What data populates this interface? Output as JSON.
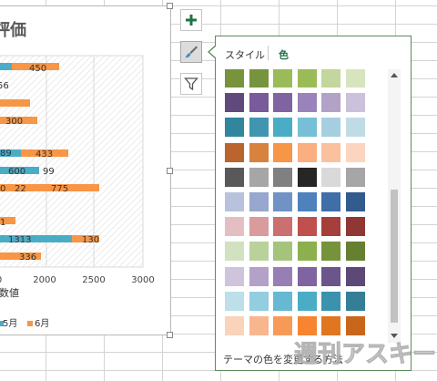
{
  "chart": {
    "title": "評価",
    "axis_title": "数値",
    "x_ticks": [
      "0",
      "2000",
      "2500",
      "3000"
    ],
    "bar_labels": [
      {
        "text": "450",
        "color": "orange"
      },
      {
        "text": "56",
        "color": "cyan"
      },
      {
        "text": "300",
        "color": "orange"
      },
      {
        "text": "89",
        "color": "cyan"
      },
      {
        "text": "433",
        "color": "orange"
      },
      {
        "text": "600",
        "color": "cyan"
      },
      {
        "text": "99",
        "color": "orange"
      },
      {
        "text": "0",
        "color": "cyan"
      },
      {
        "text": "22",
        "color": "cyan"
      },
      {
        "text": "775",
        "color": "orange"
      },
      {
        "text": "1",
        "color": "cyan"
      },
      {
        "text": "1313",
        "color": "cyan"
      },
      {
        "text": "130",
        "color": "orange"
      },
      {
        "text": "336",
        "color": "orange"
      }
    ],
    "legend": [
      {
        "label": "5月",
        "color": "#4bacc6"
      },
      {
        "label": "6月",
        "color": "#f79646"
      }
    ]
  },
  "side_buttons": [
    {
      "icon": "plus-icon",
      "name": "chart-elements-button"
    },
    {
      "icon": "brush-icon",
      "name": "chart-styles-button"
    },
    {
      "icon": "filter-icon",
      "name": "chart-filters-button"
    }
  ],
  "flyout": {
    "tabs": [
      "スタイル",
      "色"
    ],
    "active_tab": "色",
    "footer": "テーマの色を変更する方法",
    "palette_rows": [
      [
        "#77933c",
        "#77933c",
        "#9bbb59",
        "#9bbb59",
        "#c3d69b",
        "#d7e4bd"
      ],
      [
        "#604a7b",
        "#795a9a",
        "#8064a2",
        "#9a83bb",
        "#b3a2c7",
        "#ccc1da"
      ],
      [
        "#31859c",
        "#4195b1",
        "#4bacc6",
        "#76bfd6",
        "#a5cfe0",
        "#c0dbe6"
      ],
      [
        "#b9652d",
        "#d8823f",
        "#f79646",
        "#fbae7f",
        "#fbc19f",
        "#fcd5c0"
      ],
      [
        "#595959",
        "#a6a6a6",
        "#808080",
        "#262626",
        "#d9d9d9",
        "#a6a6a6"
      ],
      [
        "#b9c2dc",
        "#97a7ce",
        "#7092c5",
        "#4f81bd",
        "#3f6ea8",
        "#325b8e"
      ],
      [
        "#e4bfc1",
        "#d99b9c",
        "#cc6f70",
        "#c0504d",
        "#a53f3b",
        "#8e3734"
      ],
      [
        "#d2e1c0",
        "#b9d29b",
        "#a3c47a",
        "#8cb04e",
        "#76933c",
        "#668032"
      ],
      [
        "#cfc4dc",
        "#b2a2c8",
        "#977fb5",
        "#8064a2",
        "#6c558a",
        "#5c4976"
      ],
      [
        "#bcdfea",
        "#92cde0",
        "#67b8d3",
        "#4bacc6",
        "#3b92ac",
        "#347f96"
      ],
      [
        "#fad3bb",
        "#f8b68f",
        "#f79a58",
        "#f68430",
        "#e07620",
        "#c8671c"
      ]
    ]
  },
  "watermark": "週刊アスキー"
}
